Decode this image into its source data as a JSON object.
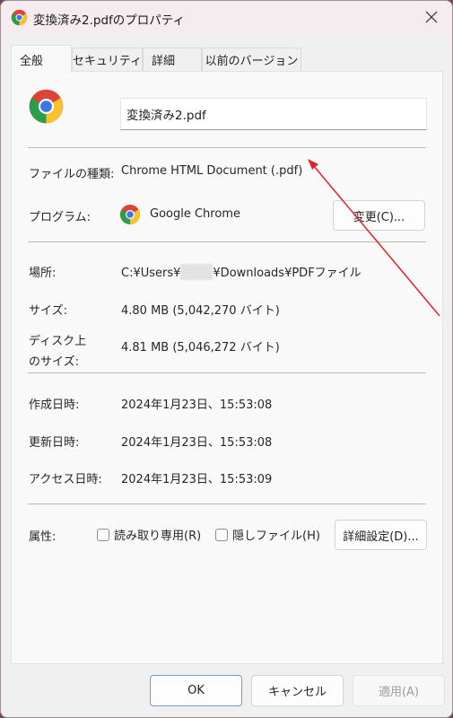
{
  "window": {
    "title": "変換済み2.pdfのプロパティ",
    "close_icon": "close-icon",
    "app_icon": "chrome-icon"
  },
  "tabs": [
    {
      "label": "全般",
      "active": true
    },
    {
      "label": "セキュリティ",
      "active": false
    },
    {
      "label": "詳細",
      "active": false
    },
    {
      "label": "以前のバージョン",
      "active": false
    }
  ],
  "general": {
    "file_name": "変換済み2.pdf",
    "file_icon": "chrome-icon",
    "type_label": "ファイルの種類:",
    "type_value": "Chrome HTML Document (.pdf)",
    "program_label": "プログラム:",
    "program_value": "Google Chrome",
    "program_icon": "chrome-icon",
    "change_button": "変更(C)...",
    "location_label": "場所:",
    "location_prefix": "C:¥Users¥",
    "location_suffix": "¥Downloads¥PDFファイル",
    "location_redacted": true,
    "size_label": "サイズ:",
    "size_value": "4.80 MB (5,042,270 バイト)",
    "disk_size_label_line1": "ディスク上",
    "disk_size_label_line2": "のサイズ:",
    "disk_size_value": "4.81 MB (5,046,272 バイト)",
    "created_label": "作成日時:",
    "created_value": "2024年1月23日、15:53:08",
    "modified_label": "更新日時:",
    "modified_value": "2024年1月23日、15:53:08",
    "accessed_label": "アクセス日時:",
    "accessed_value": "2024年1月23日、15:53:09",
    "attributes_label": "属性:",
    "readonly_label": "読み取り専用(R)",
    "readonly_checked": false,
    "hidden_label": "隠しファイル(H)",
    "hidden_checked": false,
    "advanced_button": "詳細設定(D)..."
  },
  "footer": {
    "ok": "OK",
    "cancel": "キャンセル",
    "apply": "適用(A)",
    "apply_enabled": false
  },
  "annotation": {
    "type": "arrow",
    "color": "#e8202a",
    "points_to": "type_value"
  }
}
